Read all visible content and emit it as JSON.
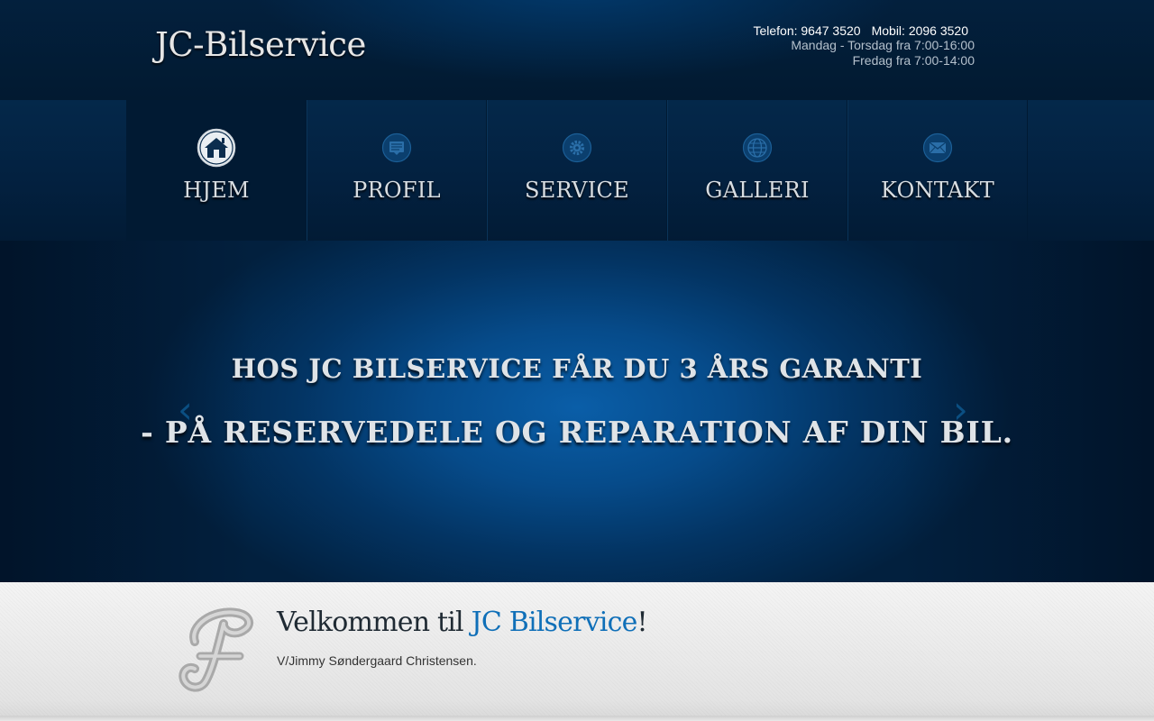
{
  "header": {
    "logo": "JC-Bilservice",
    "phone": "Telefon: 9647 3520",
    "mobile": "Mobil: 2096 3520",
    "hours_weekdays": "Mandag - Torsdag fra 7:00-16:00",
    "hours_friday": "Fredag fra 7:00-14:00"
  },
  "nav": {
    "items": [
      {
        "label": "HJEM",
        "icon": "home-icon",
        "active": true
      },
      {
        "label": "PROFIL",
        "icon": "profile-icon"
      },
      {
        "label": "SERVICE",
        "icon": "gear-icon"
      },
      {
        "label": "GALLERI",
        "icon": "globe-icon"
      },
      {
        "label": "KONTAKT",
        "icon": "mail-icon"
      }
    ]
  },
  "hero": {
    "line1": "HOS JC BILSERVICE FÅR DU 3 ÅRS GARANTI",
    "line2": "- PÅ RESERVEDELE OG REPARATION AF DIN BIL.",
    "prev_arrow": "‹",
    "next_arrow": "›"
  },
  "welcome": {
    "title_prefix": "Velkommen til ",
    "title_brand": "JC Bilservice",
    "title_suffix": "!",
    "subtitle": "V/Jimmy Søndergaard Christensen."
  },
  "colors": {
    "accent": "#0f6fb8",
    "hero_center": "#0a5ea8",
    "nav_background": "#032140",
    "welcome_background": "#efefef"
  }
}
